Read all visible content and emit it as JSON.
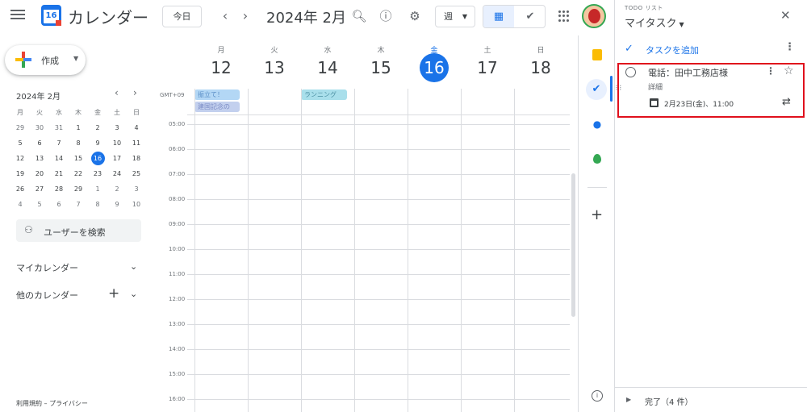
{
  "header": {
    "app_title": "カレンダー",
    "logo_day": "16",
    "today_label": "今日",
    "period": "2024年 2月",
    "view": "週",
    "prev": "‹",
    "next": "›"
  },
  "sidebar": {
    "create_label": "作成",
    "mini_title": "2024年 2月",
    "mini_dow": [
      "月",
      "火",
      "水",
      "木",
      "金",
      "土",
      "日"
    ],
    "mini_weeks": [
      [
        "29",
        "30",
        "31",
        "1",
        "2",
        "3",
        "4"
      ],
      [
        "5",
        "6",
        "7",
        "8",
        "9",
        "10",
        "11"
      ],
      [
        "12",
        "13",
        "14",
        "15",
        "16",
        "17",
        "18"
      ],
      [
        "19",
        "20",
        "21",
        "22",
        "23",
        "24",
        "25"
      ],
      [
        "26",
        "27",
        "28",
        "29",
        "1",
        "2",
        "3"
      ],
      [
        "4",
        "5",
        "6",
        "7",
        "8",
        "9",
        "10"
      ]
    ],
    "mini_today": "16",
    "people_search": "ユーザーを検索",
    "my_calendars": "マイカレンダー",
    "other_calendars": "他のカレンダー",
    "footer": "利用規約 – プライバシー"
  },
  "week": {
    "timezone": "GMT+09",
    "days": [
      {
        "dow": "月",
        "date": "12"
      },
      {
        "dow": "火",
        "date": "13"
      },
      {
        "dow": "水",
        "date": "14"
      },
      {
        "dow": "木",
        "date": "15"
      },
      {
        "dow": "金",
        "date": "16",
        "today": true
      },
      {
        "dow": "土",
        "date": "17"
      },
      {
        "dow": "日",
        "date": "18"
      }
    ],
    "allday_events": [
      {
        "title": "振立て！",
        "day": "月"
      },
      {
        "title": "建国記念の",
        "day": "月"
      },
      {
        "title": "ランニング",
        "day": "水"
      }
    ],
    "times": [
      "05:00",
      "06:00",
      "07:00",
      "08:00",
      "09:00",
      "10:00",
      "11:00",
      "12:00",
      "13:00",
      "14:00",
      "15:00",
      "16:00"
    ]
  },
  "tasks_panel": {
    "overline": "TODO リスト",
    "title": "マイタスク",
    "add_task": "タスクを追加",
    "task": {
      "title": "電話：田中工務店様",
      "details": "詳細",
      "date": "2月23日(金)、11:00"
    },
    "completed": "完了（4 件）"
  },
  "colors": {
    "accent": "#1a73e8",
    "highlight_border": "#e0101c"
  }
}
